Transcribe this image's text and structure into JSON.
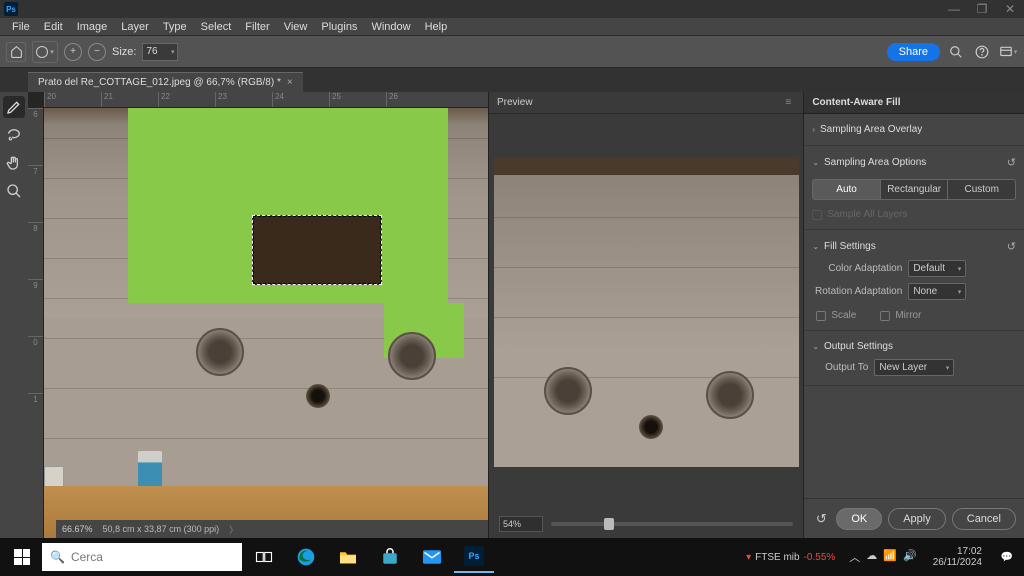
{
  "app": {
    "short": "Ps"
  },
  "menu": {
    "items": [
      "File",
      "Edit",
      "Image",
      "Layer",
      "Type",
      "Select",
      "Filter",
      "View",
      "Plugins",
      "Window",
      "Help"
    ]
  },
  "opt": {
    "size_label": "Size:",
    "size_value": "76",
    "share": "Share"
  },
  "tab": {
    "title": "Prato del Re_COTTAGE_012.jpeg @ 66,7% (RGB/8) *",
    "close": "×"
  },
  "ruler_h": [
    "20",
    "21",
    "22",
    "23",
    "24",
    "25",
    "26"
  ],
  "ruler_v": [
    "6",
    "7",
    "8",
    "9",
    "0",
    "1"
  ],
  "status": {
    "zoom": "66.67%",
    "dims": "50,8 cm x 33,87 cm (300 ppi)"
  },
  "preview": {
    "title": "Preview",
    "zoom": "54%"
  },
  "panel": {
    "title": "Content-Aware Fill",
    "sampling_overlay": "Sampling Area Overlay",
    "sampling_options": "Sampling Area Options",
    "seg": [
      "Auto",
      "Rectangular",
      "Custom"
    ],
    "sample_all": "Sample All Layers",
    "fill_settings": "Fill Settings",
    "color_adapt_lbl": "Color Adaptation",
    "color_adapt_val": "Default",
    "rot_adapt_lbl": "Rotation Adaptation",
    "rot_adapt_val": "None",
    "scale": "Scale",
    "mirror": "Mirror",
    "output_settings": "Output Settings",
    "output_to_lbl": "Output To",
    "output_to_val": "New Layer",
    "ok": "OK",
    "apply": "Apply",
    "cancel": "Cancel"
  },
  "taskbar": {
    "search": "Cerca",
    "stock_name": "FTSE mib",
    "stock_delta": "-0.55%",
    "time": "17:02",
    "date": "26/11/2024"
  }
}
